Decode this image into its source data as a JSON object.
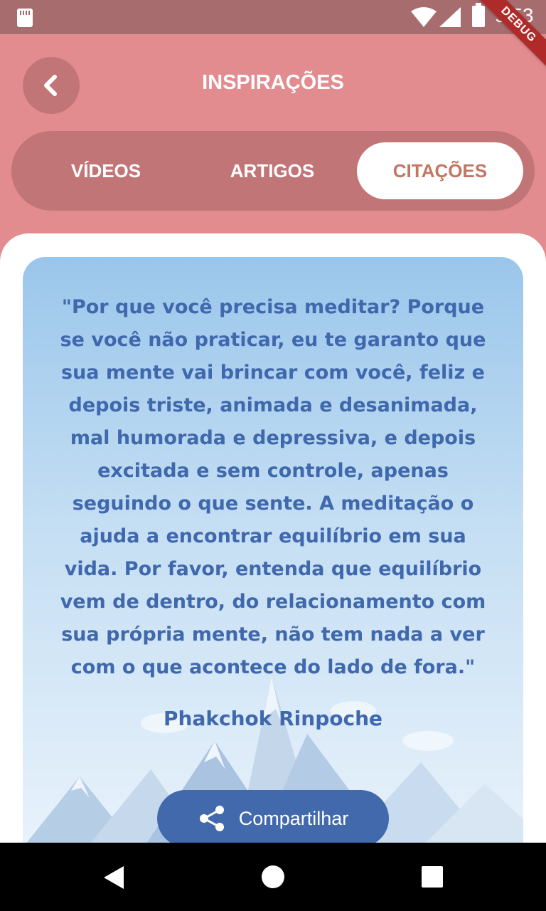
{
  "status_bar": {
    "time": "9:53",
    "debug_label": "DEBUG"
  },
  "header": {
    "title": "INSPIRAÇÕES",
    "back_icon": "chevron-left-icon"
  },
  "tabs": [
    {
      "label": "VÍDEOS",
      "active": false
    },
    {
      "label": "ARTIGOS",
      "active": false
    },
    {
      "label": "CITAÇÕES",
      "active": true
    }
  ],
  "quote": {
    "text": "\"Por que você precisa meditar? Porque se você não praticar, eu te garanto que sua mente vai brincar com você, feliz e depois triste, animada e desanimada, mal humorada e depressiva, e depois excitada e sem controle, apenas seguindo o que sente. A meditação o ajuda a encontrar equilíbrio em sua vida. Por favor, entenda que equilíbrio vem de dentro, do relacionamento com sua própria mente, não tem nada a ver com o que acontece do lado de fora.\"",
    "author": "Phakchok Rinpoche"
  },
  "share_button": {
    "label": "Compartilhar",
    "icon": "share-icon"
  },
  "colors": {
    "header_bg": "#e28c8f",
    "tab_bar_bg": "#c27577",
    "quote_text": "#3f68ad",
    "share_bg": "#4169ac",
    "active_tab_text": "#c27764"
  }
}
